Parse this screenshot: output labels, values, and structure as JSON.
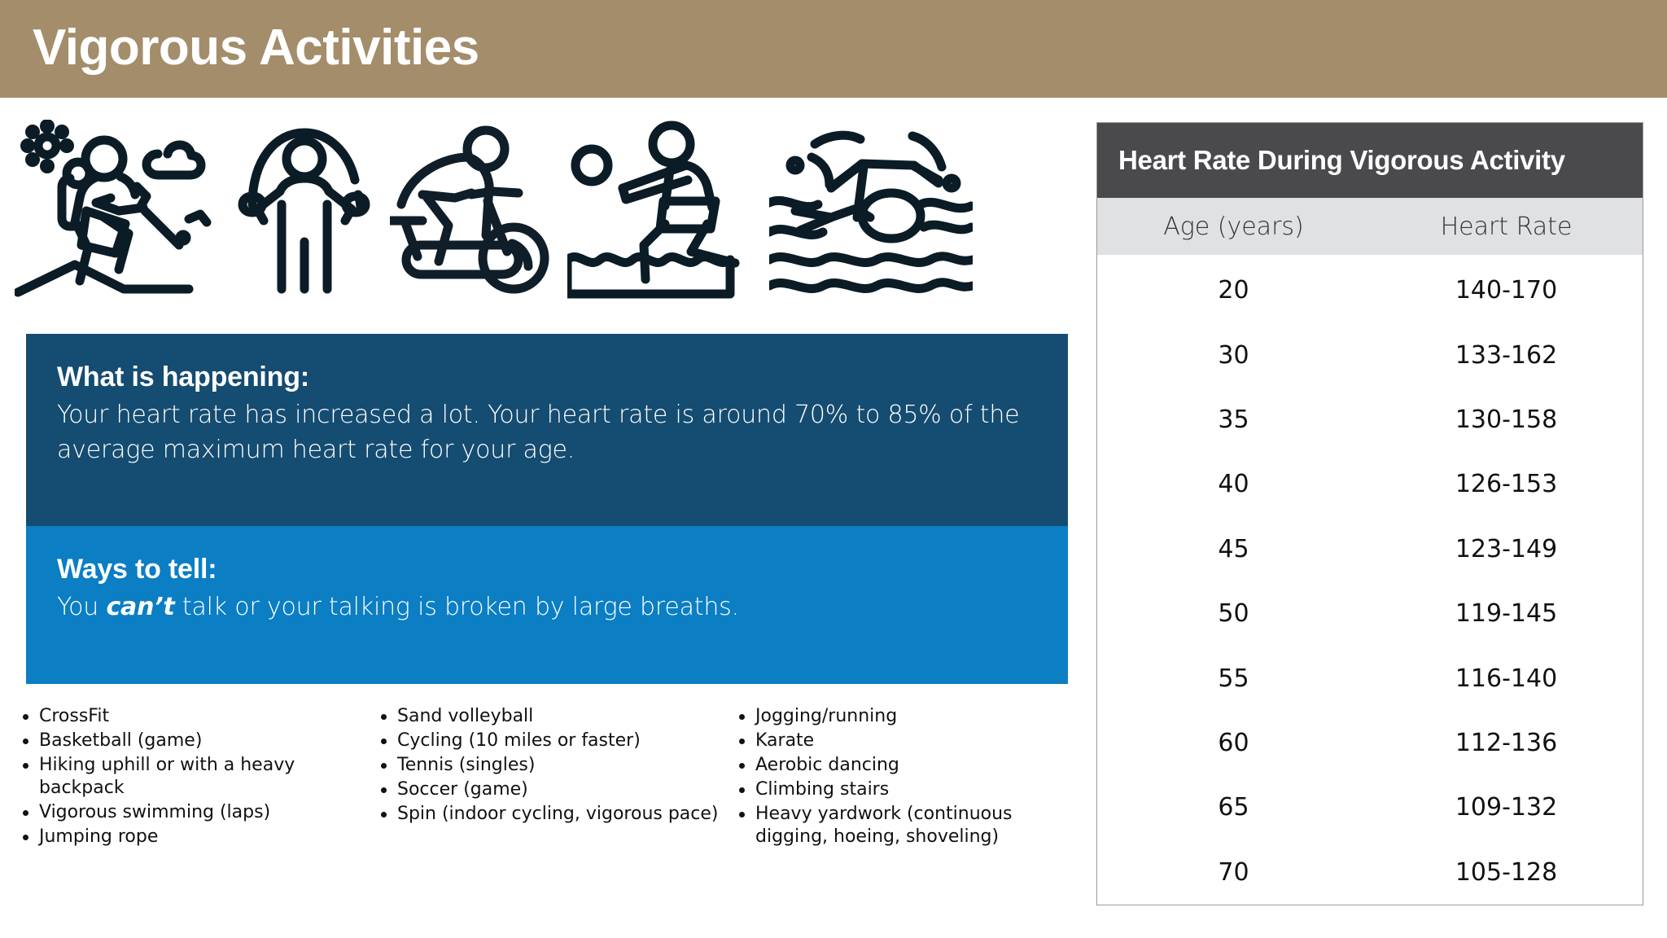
{
  "header": {
    "title": "Vigorous Activities",
    "bg_color": "#A38D6B"
  },
  "icons": [
    {
      "name": "hiking-icon",
      "label": "Hiking uphill with backpack"
    },
    {
      "name": "jump-rope-icon",
      "label": "Jumping rope"
    },
    {
      "name": "spin-bike-icon",
      "label": "Indoor cycling / spin"
    },
    {
      "name": "sand-volleyball-icon",
      "label": "Sand volleyball"
    },
    {
      "name": "swimming-icon",
      "label": "Vigorous swimming"
    }
  ],
  "panels": {
    "what_is_happening": {
      "heading": "What is happening:",
      "body_before": "Your heart rate has increased a lot. Your heart rate is around 70% to 85% of the average maximum heart rate for your age.",
      "bg_color": "#154C71"
    },
    "ways_to_tell": {
      "heading": "Ways to tell:",
      "body_prefix": "You ",
      "body_emphasis": "can’t",
      "body_suffix": " talk or your talking is broken by large breaths.",
      "bg_color": "#0B7EC4"
    }
  },
  "activity_columns": [
    {
      "items": [
        "CrossFit",
        "Basketball (game)",
        "Hiking uphill or with a heavy backpack",
        "Vigorous swimming (laps)",
        "Jumping rope"
      ]
    },
    {
      "items": [
        "Sand volleyball",
        "Cycling (10 miles or faster)",
        "Tennis (singles)",
        "Soccer (game)",
        "Spin (indoor cycling, vigorous pace)"
      ]
    },
    {
      "items": [
        "Jogging/running",
        "Karate",
        "Aerobic dancing",
        "Climbing stairs",
        "Heavy yardwork (continuous digging, hoeing, shoveling)"
      ]
    }
  ],
  "heart_rate_table": {
    "title": "Heart Rate During Vigorous Activity",
    "title_bg_color": "#4A4A4D",
    "header_bg_color": "#E0E1E2",
    "columns": [
      "Age (years)",
      "Heart Rate"
    ],
    "rows": [
      {
        "age": "20",
        "rate": "140-170"
      },
      {
        "age": "30",
        "rate": "133-162"
      },
      {
        "age": "35",
        "rate": "130-158"
      },
      {
        "age": "40",
        "rate": "126-153"
      },
      {
        "age": "45",
        "rate": "123-149"
      },
      {
        "age": "50",
        "rate": "119-145"
      },
      {
        "age": "55",
        "rate": "116-140"
      },
      {
        "age": "60",
        "rate": "112-136"
      },
      {
        "age": "65",
        "rate": "109-132"
      },
      {
        "age": "70",
        "rate": "105-128"
      }
    ]
  }
}
